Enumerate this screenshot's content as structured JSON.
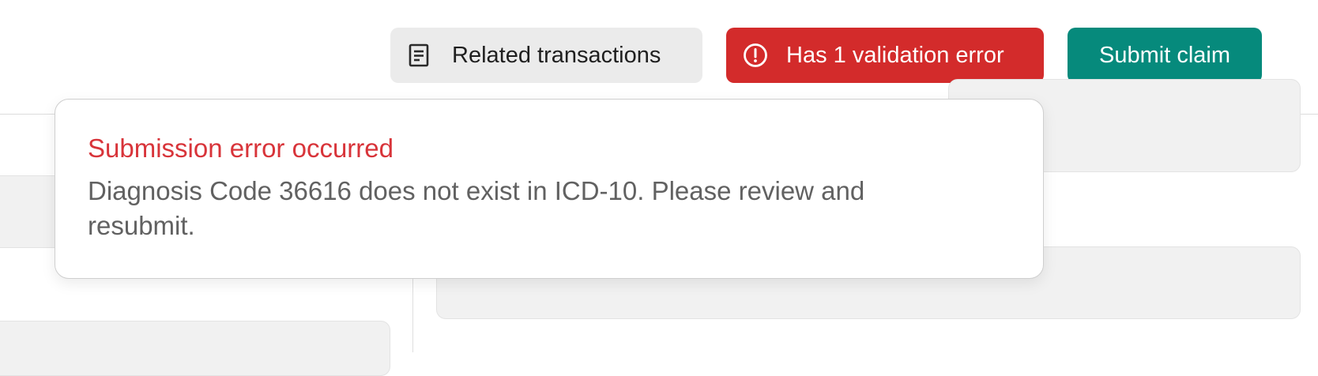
{
  "toolbar": {
    "related_label": "Related transactions",
    "related_icon": "document-list-icon",
    "error_label": "Has 1 validation error",
    "error_icon": "alert-circle-icon",
    "submit_label": "Submit claim"
  },
  "error_popover": {
    "title": "Submission error occurred",
    "message": "Diagnosis Code 36616 does not exist in ICD-10. Please review and resubmit."
  },
  "colors": {
    "error_red": "#d32b2b",
    "submit_teal": "#068a7c",
    "neutral_button": "#ebebeb",
    "error_title": "#d8343a",
    "message_text": "#616161"
  }
}
